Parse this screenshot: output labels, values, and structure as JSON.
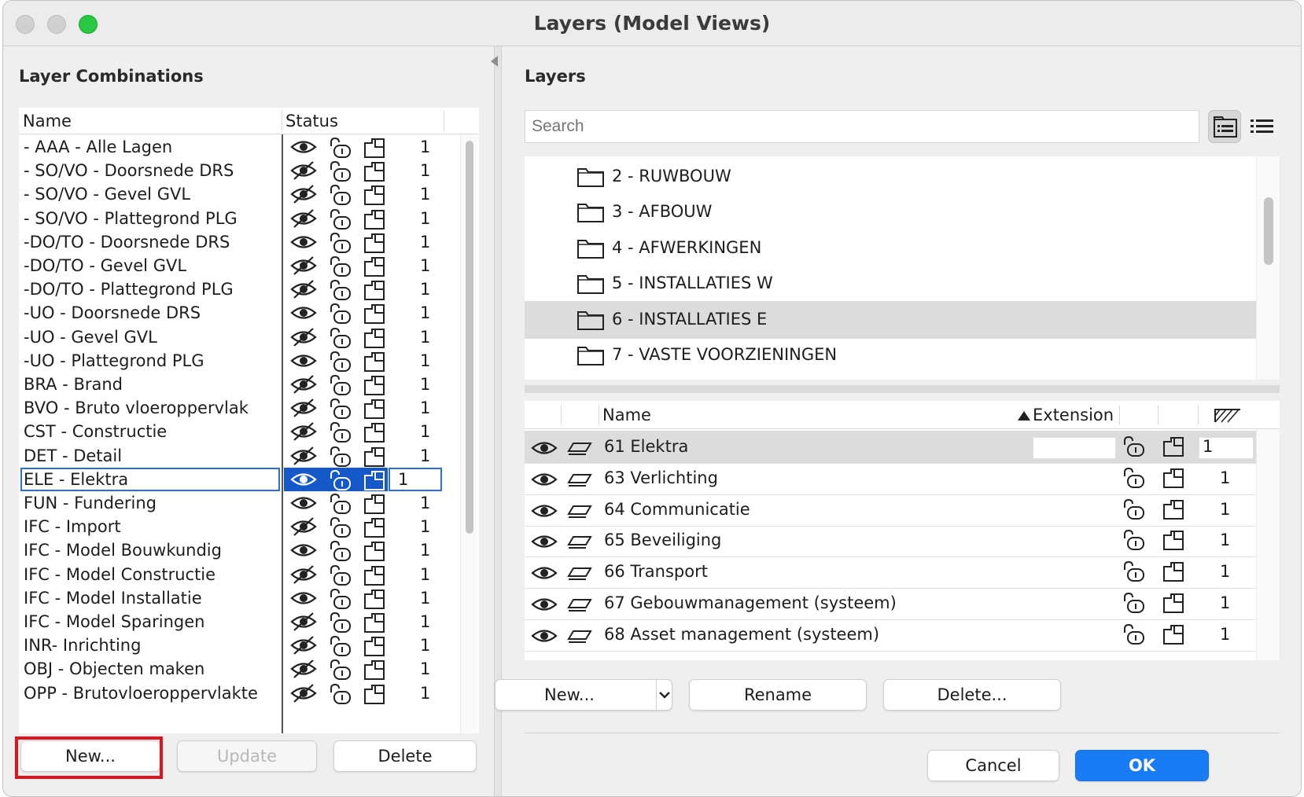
{
  "window": {
    "title": "Layers (Model Views)"
  },
  "left": {
    "section_title": "Layer Combinations",
    "col_name": "Name",
    "col_status": "Status",
    "rows": [
      {
        "name": "- AAA - Alle Lagen",
        "visible": true,
        "num": "1"
      },
      {
        "name": "- SO/VO - Doorsnede DRS",
        "visible": false,
        "num": "1"
      },
      {
        "name": "- SO/VO - Gevel GVL",
        "visible": false,
        "num": "1"
      },
      {
        "name": "- SO/VO - Plattegrond PLG",
        "visible": false,
        "num": "1"
      },
      {
        "name": "-DO/TO - Doorsnede DRS",
        "visible": true,
        "num": "1"
      },
      {
        "name": "-DO/TO - Gevel GVL",
        "visible": false,
        "num": "1"
      },
      {
        "name": "-DO/TO - Plattegrond PLG",
        "visible": false,
        "num": "1"
      },
      {
        "name": "-UO - Doorsnede DRS",
        "visible": true,
        "num": "1"
      },
      {
        "name": "-UO - Gevel GVL",
        "visible": false,
        "num": "1"
      },
      {
        "name": "-UO - Plattegrond PLG",
        "visible": true,
        "num": "1"
      },
      {
        "name": "BRA - Brand",
        "visible": false,
        "num": "1"
      },
      {
        "name": "BVO - Bruto vloeroppervlak",
        "visible": false,
        "num": "1"
      },
      {
        "name": "CST - Constructie",
        "visible": false,
        "num": "1"
      },
      {
        "name": "DET - Detail",
        "visible": false,
        "num": "1"
      },
      {
        "name": "ELE - Elektra",
        "visible": true,
        "num": "1",
        "selected": true
      },
      {
        "name": "FUN - Fundering",
        "visible": true,
        "num": "1"
      },
      {
        "name": "IFC - Import",
        "visible": false,
        "num": "1"
      },
      {
        "name": "IFC - Model Bouwkundig",
        "visible": true,
        "num": "1"
      },
      {
        "name": "IFC - Model Constructie",
        "visible": false,
        "num": "1"
      },
      {
        "name": "IFC - Model Installatie",
        "visible": true,
        "num": "1"
      },
      {
        "name": "IFC - Model Sparingen",
        "visible": false,
        "num": "1"
      },
      {
        "name": "INR- Inrichting",
        "visible": false,
        "num": "1"
      },
      {
        "name": "OBJ - Objecten maken",
        "visible": false,
        "num": "1"
      },
      {
        "name": "OPP - Brutovloeroppervlakte",
        "visible": false,
        "num": "1"
      }
    ],
    "buttons": {
      "new": "New...",
      "update": "Update",
      "delete": "Delete"
    }
  },
  "right": {
    "section_title": "Layers",
    "search_placeholder": "Search",
    "folders": [
      {
        "label": "2 - RUWBOUW"
      },
      {
        "label": "3 - AFBOUW"
      },
      {
        "label": "4 - AFWERKINGEN"
      },
      {
        "label": "5 - INSTALLATIES W"
      },
      {
        "label": "6 - INSTALLATIES E",
        "selected": true
      },
      {
        "label": "7 - VASTE VOORZIENINGEN"
      }
    ],
    "col_name": "Name",
    "col_extension": "Extension",
    "layers": [
      {
        "name": "61 Elektra",
        "num": "1",
        "selected": true
      },
      {
        "name": "63 Verlichting",
        "num": "1"
      },
      {
        "name": "64 Communicatie",
        "num": "1"
      },
      {
        "name": "65 Beveiliging",
        "num": "1"
      },
      {
        "name": "66 Transport",
        "num": "1"
      },
      {
        "name": "67 Gebouwmanagement (systeem)",
        "num": "1"
      },
      {
        "name": "68 Asset management (systeem)",
        "num": "1"
      }
    ],
    "buttons": {
      "new": "New...",
      "rename": "Rename",
      "delete": "Delete...",
      "cancel": "Cancel",
      "ok": "OK"
    }
  },
  "colors": {
    "accent": "#1a7cf5",
    "selection": "#1558c9",
    "highlight": "#e0141e"
  }
}
